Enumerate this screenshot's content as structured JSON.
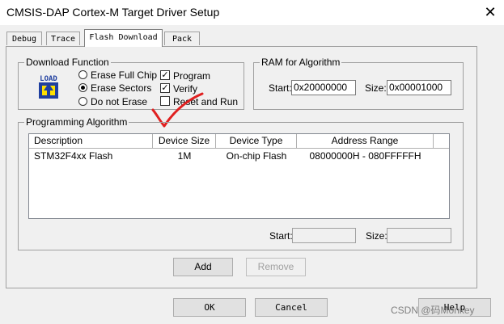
{
  "window": {
    "title": "CMSIS-DAP Cortex-M Target Driver Setup",
    "close_glyph": "✕"
  },
  "tabs": [
    {
      "label": "Debug",
      "active": false
    },
    {
      "label": "Trace",
      "active": false
    },
    {
      "label": "Flash Download",
      "active": true
    },
    {
      "label": "Pack",
      "active": false
    }
  ],
  "download_function": {
    "title": "Download Function",
    "icon_text": "LOAD",
    "erase_options": [
      {
        "label": "Erase Full Chip",
        "selected": false
      },
      {
        "label": "Erase Sectors",
        "selected": true
      },
      {
        "label": "Do not Erase",
        "selected": false
      }
    ],
    "checkboxes": [
      {
        "label": "Program",
        "checked": true
      },
      {
        "label": "Verify",
        "checked": true
      },
      {
        "label": "Reset and Run",
        "checked": false
      }
    ]
  },
  "ram": {
    "title": "RAM for Algorithm",
    "start_label": "Start:",
    "start_value": "0x20000000",
    "size_label": "Size:",
    "size_value": "0x00001000"
  },
  "algorithm": {
    "title": "Programming Algorithm",
    "columns": [
      "Description",
      "Device Size",
      "Device Type",
      "Address Range"
    ],
    "rows": [
      {
        "description": "STM32F4xx Flash",
        "size": "1M",
        "type": "On-chip Flash",
        "range": "08000000H - 080FFFFFH"
      }
    ],
    "start_label": "Start:",
    "start_value": "",
    "size_label": "Size:",
    "size_value": "",
    "add_label": "Add",
    "remove_label": "Remove"
  },
  "dialog_buttons": {
    "ok": "OK",
    "cancel": "Cancel",
    "help": "Help"
  },
  "watermark": "CSDN @码Monkey",
  "colors": {
    "annotation_red": "#e02020",
    "load_icon_blue": "#1f3f9f",
    "load_icon_yellow": "#ffe000"
  }
}
